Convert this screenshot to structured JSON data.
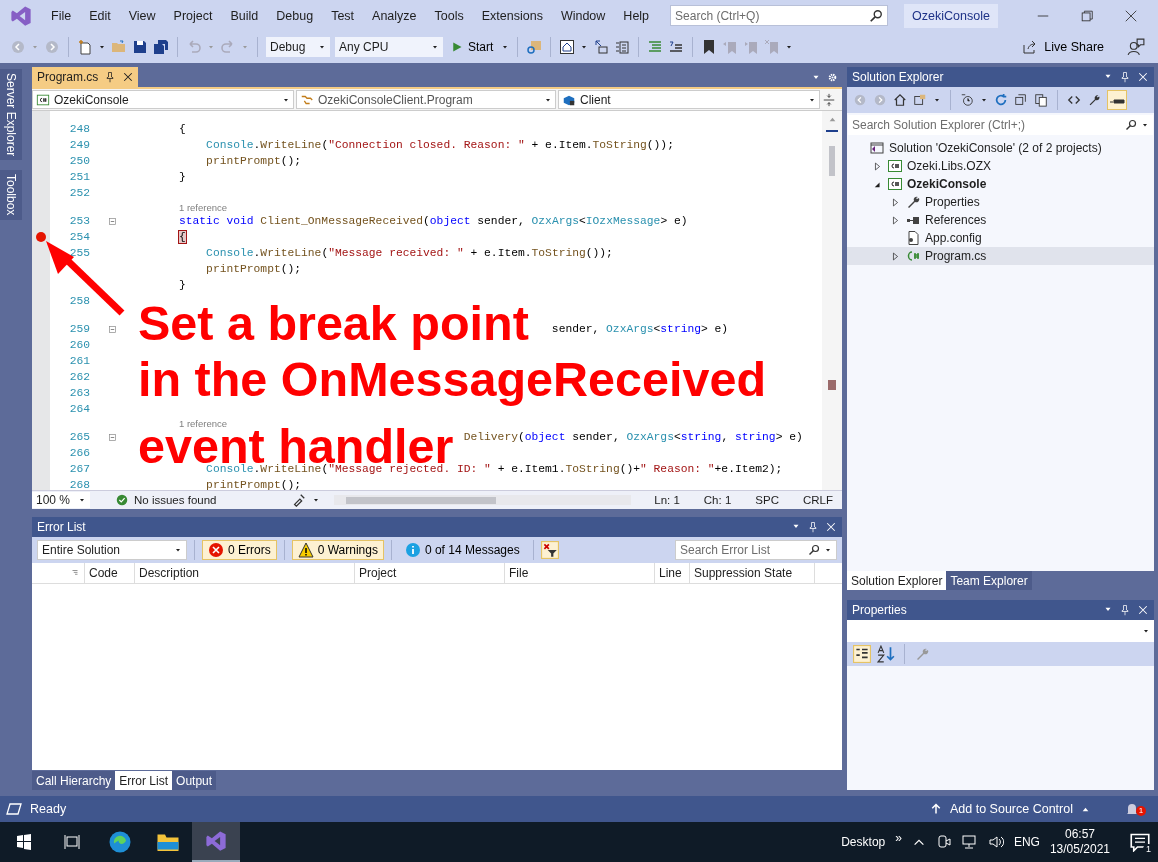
{
  "menu": [
    "File",
    "Edit",
    "View",
    "Project",
    "Build",
    "Debug",
    "Test",
    "Analyze",
    "Tools",
    "Extensions",
    "Window",
    "Help"
  ],
  "search": {
    "placeholder": "Search (Ctrl+Q)"
  },
  "solution_badge": "OzekiConsole",
  "toolbar": {
    "configuration": "Debug",
    "platform": "Any CPU",
    "start": "Start",
    "live_share": "Live Share"
  },
  "side_tabs": [
    "Server Explorer",
    "Toolbox"
  ],
  "editor": {
    "tabs": [
      {
        "label": "Program.cs",
        "selected": true
      }
    ],
    "navigation": [
      "OzekiConsole",
      "OzekiConsoleClient.Program",
      "Client"
    ],
    "lines": [
      {
        "kind": "code",
        "num": "248",
        "breakpoint": false,
        "tokens": [
          {
            "kind": "plain",
            "text": "{"
          }
        ]
      },
      {
        "kind": "code",
        "num": "249",
        "breakpoint": false,
        "tokens": [
          {
            "kind": "type",
            "text": "    Console"
          },
          {
            "kind": "plain",
            "text": "."
          },
          {
            "kind": "method",
            "text": "WriteLine"
          },
          {
            "kind": "plain",
            "text": "("
          },
          {
            "kind": "string",
            "text": "\"Connection closed. Reason: \""
          },
          {
            "kind": "plain",
            "text": " + e.Item."
          },
          {
            "kind": "method",
            "text": "ToString"
          },
          {
            "kind": "plain",
            "text": "());"
          }
        ]
      },
      {
        "kind": "code",
        "num": "250",
        "breakpoint": false,
        "tokens": [
          {
            "kind": "method",
            "text": "    printPrompt"
          },
          {
            "kind": "plain",
            "text": "();"
          }
        ]
      },
      {
        "kind": "code",
        "num": "251",
        "breakpoint": false,
        "tokens": [
          {
            "kind": "plain",
            "text": "}"
          }
        ]
      },
      {
        "kind": "code",
        "num": "252",
        "breakpoint": false
      },
      {
        "kind": "reference",
        "text": "1 reference"
      },
      {
        "kind": "header",
        "num": "253",
        "breakpoint": false,
        "tokens": [
          {
            "kind": "keyword",
            "text": "static void "
          },
          {
            "kind": "method",
            "text": "Client_OnMessageReceived"
          },
          {
            "kind": "plain",
            "text": "("
          },
          {
            "kind": "keyword",
            "text": "object"
          },
          {
            "kind": "plain",
            "text": " sender, "
          },
          {
            "kind": "type",
            "text": "OzxArgs"
          },
          {
            "kind": "plain",
            "text": "<"
          },
          {
            "kind": "type",
            "text": "IOzxMessage"
          },
          {
            "kind": "plain",
            "text": "> e)"
          }
        ]
      },
      {
        "kind": "code",
        "num": "254",
        "breakpoint": true,
        "tokens": [
          {
            "kind": "plain",
            "text": "{"
          }
        ]
      },
      {
        "kind": "code",
        "num": "255",
        "breakpoint": false,
        "tokens": [
          {
            "kind": "type",
            "text": "    Console"
          },
          {
            "kind": "plain",
            "text": "."
          },
          {
            "kind": "method",
            "text": "WriteLine"
          },
          {
            "kind": "plain",
            "text": "("
          },
          {
            "kind": "string",
            "text": "\"Message received: \""
          },
          {
            "kind": "plain",
            "text": " + e.Item."
          },
          {
            "kind": "method",
            "text": "ToString"
          },
          {
            "kind": "plain",
            "text": "());"
          }
        ]
      },
      {
        "kind": "code",
        "breakpoint": false,
        "tokens": [
          {
            "kind": "method",
            "text": "    printPrompt"
          },
          {
            "kind": "plain",
            "text": "();"
          }
        ]
      },
      {
        "kind": "code",
        "breakpoint": false,
        "tokens": [
          {
            "kind": "plain",
            "text": "}"
          }
        ]
      },
      {
        "kind": "code",
        "num": "258",
        "breakpoint": false
      },
      {
        "kind": "blank"
      },
      {
        "kind": "header",
        "num": "259",
        "breakpoint": false,
        "tokens": [
          {
            "kind": "plain",
            "text": "                                                       sender, "
          },
          {
            "kind": "type",
            "text": "OzxArgs"
          },
          {
            "kind": "plain",
            "text": "<"
          },
          {
            "kind": "keyword",
            "text": "string"
          },
          {
            "kind": "plain",
            "text": "> e)"
          }
        ]
      },
      {
        "kind": "code",
        "num": "260",
        "breakpoint": false
      },
      {
        "kind": "code",
        "num": "261",
        "breakpoint": false
      },
      {
        "kind": "code",
        "num": "262",
        "breakpoint": false
      },
      {
        "kind": "code",
        "num": "263",
        "breakpoint": false
      },
      {
        "kind": "code",
        "num": "264",
        "breakpoint": false
      },
      {
        "kind": "reference",
        "text": "1 reference"
      },
      {
        "kind": "header",
        "num": "265",
        "breakpoint": false,
        "tokens": [
          {
            "kind": "method",
            "text": "                                          Delivery"
          },
          {
            "kind": "plain",
            "text": "("
          },
          {
            "kind": "keyword",
            "text": "object"
          },
          {
            "kind": "plain",
            "text": " sender, "
          },
          {
            "kind": "type",
            "text": "OzxArgs"
          },
          {
            "kind": "plain",
            "text": "<"
          },
          {
            "kind": "keyword",
            "text": "string"
          },
          {
            "kind": "plain",
            "text": ", "
          },
          {
            "kind": "keyword",
            "text": "string"
          },
          {
            "kind": "plain",
            "text": "> e)"
          }
        ]
      },
      {
        "kind": "code",
        "num": "266",
        "breakpoint": false
      },
      {
        "kind": "code",
        "num": "267",
        "breakpoint": false,
        "tokens": [
          {
            "kind": "type",
            "text": "    Console"
          },
          {
            "kind": "plain",
            "text": "."
          },
          {
            "kind": "method",
            "text": "WriteLine"
          },
          {
            "kind": "plain",
            "text": "("
          },
          {
            "kind": "string",
            "text": "\"Message rejected. ID: \""
          },
          {
            "kind": "plain",
            "text": " + e.Item1."
          },
          {
            "kind": "method",
            "text": "ToString"
          },
          {
            "kind": "plain",
            "text": "()+"
          },
          {
            "kind": "string",
            "text": "\" Reason: \""
          },
          {
            "kind": "plain",
            "text": "+e.Item2);"
          }
        ]
      },
      {
        "kind": "code",
        "num": "268",
        "breakpoint": false,
        "tokens": [
          {
            "kind": "method",
            "text": "    printPrompt"
          },
          {
            "kind": "plain",
            "text": "();"
          }
        ]
      }
    ],
    "status": {
      "zoom": "100 %",
      "issues": "No issues found",
      "line": "Ln: 1",
      "column": "Ch: 1",
      "whitespace": "SPC",
      "line_ending": "CRLF"
    }
  },
  "annotation": {
    "lines": [
      "Set a break point",
      "in the OnMessageReceived",
      "event handler"
    ]
  },
  "error_list": {
    "title": "Error List",
    "scope": "Entire Solution",
    "filters": [
      {
        "kind": "errors",
        "label": "0 Errors",
        "selected": true
      },
      {
        "kind": "warnings",
        "label": "0 Warnings",
        "selected": true
      },
      {
        "kind": "messages",
        "label": "0 of 14 Messages",
        "selected": false
      }
    ],
    "search": {
      "placeholder": "Search Error List"
    },
    "columns": [
      "Code",
      "Description",
      "Project",
      "File",
      "Line",
      "Suppression State"
    ]
  },
  "bottom_tabs": [
    {
      "label": "Call Hierarchy",
      "selected": false
    },
    {
      "label": "Error List",
      "selected": true
    },
    {
      "label": "Output",
      "selected": false
    }
  ],
  "solution_explorer": {
    "title": "Solution Explorer",
    "search": {
      "placeholder": "Search Solution Explorer (Ctrl+;)"
    },
    "tree": [
      {
        "kind": "solution",
        "label": "Solution 'OzekiConsole' (2 of 2 projects)",
        "selected": false,
        "children": [
          {
            "kind": "project",
            "label": "Ozeki.Libs.OZX",
            "expanded": false,
            "startup": false,
            "selected": false
          },
          {
            "kind": "project",
            "label": "OzekiConsole",
            "expanded": true,
            "startup": true,
            "selected": false,
            "children": [
              {
                "kind": "properties",
                "label": "Properties",
                "expanded": false,
                "selected": false
              },
              {
                "kind": "references",
                "label": "References",
                "expanded": false,
                "selected": false
              },
              {
                "kind": "config",
                "label": "App.config",
                "selected": false
              },
              {
                "kind": "csfile",
                "label": "Program.cs",
                "expanded": false,
                "selected": true
              }
            ]
          }
        ]
      }
    ],
    "tabs": [
      {
        "label": "Solution Explorer",
        "selected": true
      },
      {
        "label": "Team Explorer",
        "selected": false
      }
    ]
  },
  "properties": {
    "title": "Properties"
  },
  "status_bar": {
    "text": "Ready",
    "source_control": "Add to Source Control",
    "notifications": "1"
  },
  "taskbar": {
    "desktop": "Desktop",
    "chevron": "»",
    "language": "ENG",
    "time": "06:57",
    "date": "13/05/2021",
    "notifications": "1"
  }
}
